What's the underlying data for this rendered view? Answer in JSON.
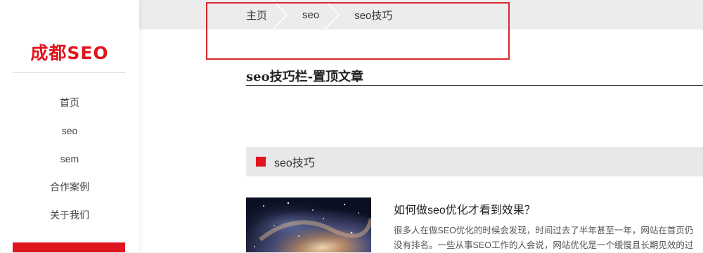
{
  "sidebar": {
    "logo": "成都SEO",
    "nav": [
      "首页",
      "seo",
      "sem",
      "合作案例",
      "关于我们"
    ]
  },
  "breadcrumb": [
    "主页",
    "seo",
    "seo技巧"
  ],
  "page": {
    "title": "seo技巧栏-置顶文章"
  },
  "section": {
    "label": "seo技巧"
  },
  "article": {
    "title": "如何做seo优化才看到效果？",
    "excerpt_line1": "很多人在做SEO优化的时候会发现，时间过去了半年甚至一年，网站在首页仍",
    "excerpt_line2": "没有排名。一些从事SEO工作的人会说，网站优化是一个缓慢且长期见效的过"
  },
  "colors": {
    "brand": "#e0141e",
    "highlight": "#d9262e"
  }
}
